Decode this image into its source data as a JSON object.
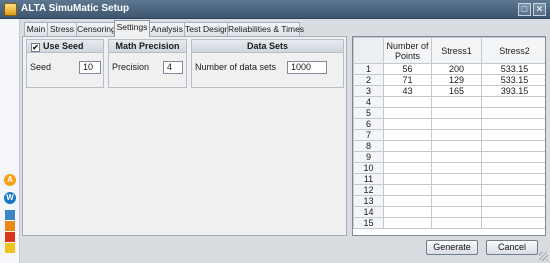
{
  "window": {
    "title": "ALTA SimuMatic Setup"
  },
  "tabs": [
    {
      "label": "Main"
    },
    {
      "label": "Stress"
    },
    {
      "label": "Censoring"
    },
    {
      "label": "Settings",
      "active": true
    },
    {
      "label": "Analysis"
    },
    {
      "label": "Test Design"
    },
    {
      "label": "Reliabilities & Times"
    }
  ],
  "settings": {
    "use_seed": {
      "label": "Use Seed",
      "checked": true
    },
    "seed": {
      "label": "Seed",
      "value": "10"
    },
    "math_precision": {
      "header": "Math Precision",
      "label": "Precision",
      "value": "4"
    },
    "data_sets": {
      "header": "Data Sets",
      "label": "Number of data sets",
      "value": "1000"
    }
  },
  "grid": {
    "columns": [
      "Number of Points",
      "Stress1",
      "Stress2"
    ],
    "rows": [
      {
        "num": "1",
        "cells": [
          "56",
          "200",
          "533.15"
        ]
      },
      {
        "num": "2",
        "cells": [
          "71",
          "129",
          "533.15"
        ]
      },
      {
        "num": "3",
        "cells": [
          "43",
          "165",
          "393.15"
        ]
      },
      {
        "num": "4",
        "cells": [
          "",
          "",
          ""
        ]
      },
      {
        "num": "5",
        "cells": [
          "",
          "",
          ""
        ]
      },
      {
        "num": "6",
        "cells": [
          "",
          "",
          ""
        ]
      },
      {
        "num": "7",
        "cells": [
          "",
          "",
          ""
        ]
      },
      {
        "num": "8",
        "cells": [
          "",
          "",
          ""
        ]
      },
      {
        "num": "9",
        "cells": [
          "",
          "",
          ""
        ]
      },
      {
        "num": "10",
        "cells": [
          "",
          "",
          ""
        ]
      },
      {
        "num": "11",
        "cells": [
          "",
          "",
          ""
        ]
      },
      {
        "num": "12",
        "cells": [
          "",
          "",
          ""
        ]
      },
      {
        "num": "13",
        "cells": [
          "",
          "",
          ""
        ]
      },
      {
        "num": "14",
        "cells": [
          "",
          "",
          ""
        ]
      },
      {
        "num": "15",
        "cells": [
          "",
          "",
          ""
        ]
      }
    ]
  },
  "buttons": {
    "generate": "Generate",
    "cancel": "Cancel"
  },
  "side_icons": [
    "alta-logo-icon",
    "weibull-logo-icon"
  ],
  "colors": {
    "title_bar": "#4a6580",
    "panel": "#f0f0f0",
    "accent_orange": "#f6a019",
    "accent_blue": "#1877c9"
  }
}
